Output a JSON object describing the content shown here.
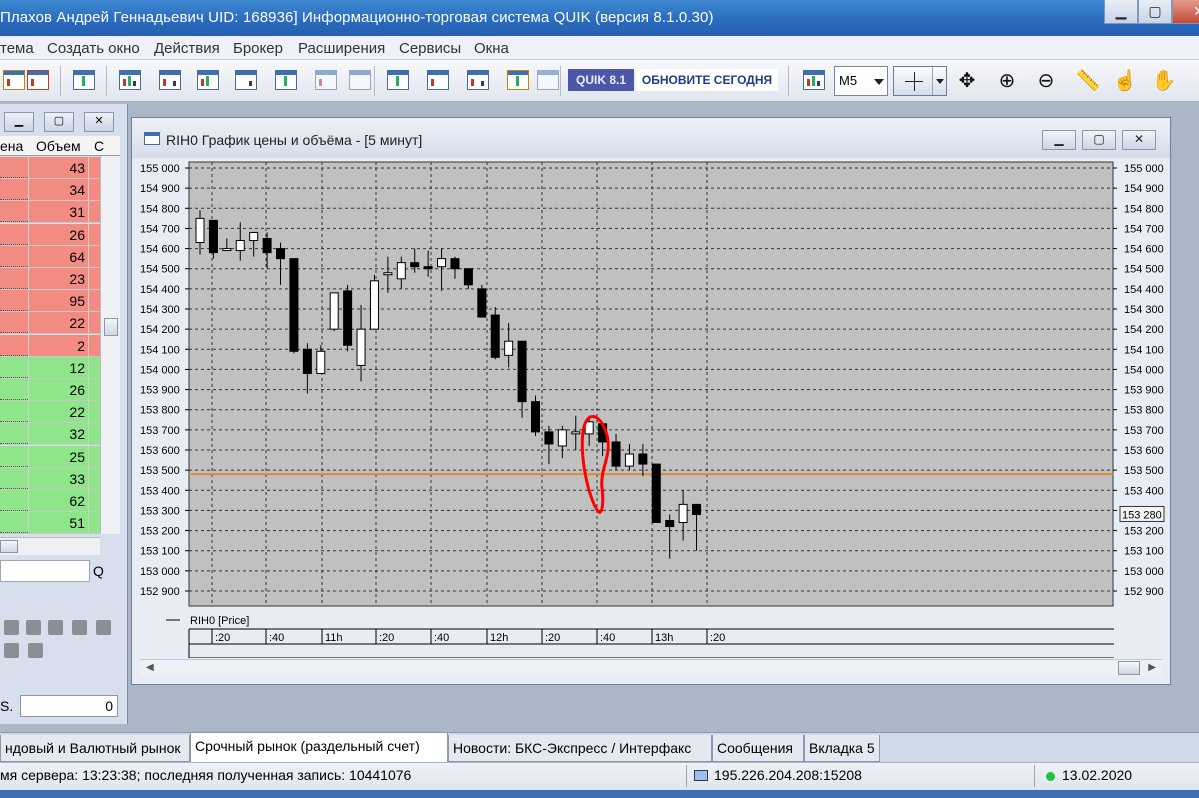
{
  "window": {
    "title": "Плахов Андрей Геннадьевич UID: 168936] Информационно-торговая система QUIK (версия 8.1.0.30)",
    "minimize": "▁",
    "maximize": "▢",
    "close": "✕"
  },
  "menu": [
    "тема",
    "Создать окно",
    "Действия",
    "Брокер",
    "Расширения",
    "Сервисы",
    "Окна"
  ],
  "toolbar": {
    "quik_badge": "QUIK 8.1",
    "update_label": "ОБНОВИТЕ СЕГОДНЯ",
    "interval": "M5"
  },
  "left_panel": {
    "col_price": "ена",
    "col_volume": "Объем",
    "col_third": "С",
    "sell_volumes": [
      "43",
      "34",
      "31",
      "26",
      "64",
      "23",
      "95",
      "22",
      "2"
    ],
    "buy_volumes": [
      "12",
      "26",
      "22",
      "32",
      "25",
      "33",
      "62",
      "51"
    ],
    "sell_color": "#f28b82",
    "buy_color": "#8ee58a",
    "search_label": "Q",
    "field_label": "S.",
    "field_value": "0"
  },
  "chart_window": {
    "title": "RIH0 График цены и объёма - [5 минут]",
    "legend": "RIH0 [Price]",
    "last_price_label": "153 280",
    "level_color": "#e08a2c",
    "annotation_color": "#ff0000"
  },
  "chart_data": {
    "type": "candlestick",
    "y_ticks": [
      "155 000",
      "154 900",
      "154 800",
      "154 700",
      "154 600",
      "154 500",
      "154 400",
      "154 300",
      "154 200",
      "154 100",
      "154 000",
      "153 900",
      "153 800",
      "153 700",
      "153 600",
      "153 500",
      "153 400",
      "153 300",
      "153 200",
      "153 100",
      "153 000",
      "152 900"
    ],
    "ylim": [
      152900,
      155000
    ],
    "time_labels": [
      ":20",
      ":40",
      "11h",
      ":20",
      ":40",
      "12h",
      ":20",
      ":40",
      "13h",
      ":20"
    ],
    "horizontal_level": 153480,
    "candles": [
      {
        "o": 154630,
        "h": 154790,
        "l": 154570,
        "c": 154750
      },
      {
        "o": 154740,
        "h": 154740,
        "l": 154550,
        "c": 154580
      },
      {
        "o": 154600,
        "h": 154650,
        "l": 154600,
        "c": 154600
      },
      {
        "o": 154590,
        "h": 154730,
        "l": 154540,
        "c": 154640
      },
      {
        "o": 154640,
        "h": 154660,
        "l": 154560,
        "c": 154680
      },
      {
        "o": 154650,
        "h": 154680,
        "l": 154500,
        "c": 154580
      },
      {
        "o": 154600,
        "h": 154630,
        "l": 154420,
        "c": 154550
      },
      {
        "o": 154550,
        "h": 154550,
        "l": 154080,
        "c": 154090
      },
      {
        "o": 154100,
        "h": 154130,
        "l": 153880,
        "c": 153980
      },
      {
        "o": 153980,
        "h": 154120,
        "l": 153980,
        "c": 154090
      },
      {
        "o": 154200,
        "h": 154380,
        "l": 154190,
        "c": 154380
      },
      {
        "o": 154390,
        "h": 154420,
        "l": 154090,
        "c": 154120
      },
      {
        "o": 154020,
        "h": 154320,
        "l": 153940,
        "c": 154200
      },
      {
        "o": 154200,
        "h": 154470,
        "l": 154200,
        "c": 154440
      },
      {
        "o": 154470,
        "h": 154560,
        "l": 154380,
        "c": 154480
      },
      {
        "o": 154450,
        "h": 154560,
        "l": 154400,
        "c": 154530
      },
      {
        "o": 154530,
        "h": 154600,
        "l": 154480,
        "c": 154510
      },
      {
        "o": 154510,
        "h": 154590,
        "l": 154460,
        "c": 154500
      },
      {
        "o": 154510,
        "h": 154600,
        "l": 154390,
        "c": 154550
      },
      {
        "o": 154550,
        "h": 154560,
        "l": 154450,
        "c": 154500
      },
      {
        "o": 154500,
        "h": 154500,
        "l": 154400,
        "c": 154420
      },
      {
        "o": 154400,
        "h": 154420,
        "l": 154270,
        "c": 154260
      },
      {
        "o": 154270,
        "h": 154310,
        "l": 154050,
        "c": 154060
      },
      {
        "o": 154070,
        "h": 154230,
        "l": 154010,
        "c": 154140
      },
      {
        "o": 154140,
        "h": 154140,
        "l": 153760,
        "c": 153840
      },
      {
        "o": 153840,
        "h": 153870,
        "l": 153670,
        "c": 153690
      },
      {
        "o": 153690,
        "h": 153720,
        "l": 153530,
        "c": 153630
      },
      {
        "o": 153620,
        "h": 153720,
        "l": 153560,
        "c": 153700
      },
      {
        "o": 153690,
        "h": 153770,
        "l": 153600,
        "c": 153690
      },
      {
        "o": 153680,
        "h": 153770,
        "l": 153620,
        "c": 153740
      },
      {
        "o": 153730,
        "h": 153730,
        "l": 153570,
        "c": 153640
      },
      {
        "o": 153640,
        "h": 153680,
        "l": 153500,
        "c": 153520
      },
      {
        "o": 153520,
        "h": 153630,
        "l": 153500,
        "c": 153580
      },
      {
        "o": 153580,
        "h": 153630,
        "l": 153470,
        "c": 153530
      },
      {
        "o": 153530,
        "h": 153530,
        "l": 153240,
        "c": 153240
      },
      {
        "o": 153250,
        "h": 153280,
        "l": 153060,
        "c": 153220
      },
      {
        "o": 153240,
        "h": 153400,
        "l": 153150,
        "c": 153330
      },
      {
        "o": 153330,
        "h": 153330,
        "l": 153100,
        "c": 153280
      }
    ]
  },
  "tabs": [
    "ндовый и Валютный рынок",
    "Срочный рынок (раздельный счет)",
    "Новости: БКС-Экспресс / Интерфакс",
    "Сообщения",
    "Вкладка 5"
  ],
  "status": {
    "server": "мя сервера: 13:23:38; последняя полученная запись: 10441076",
    "address": "195.226.204.208:15208",
    "date": "13.02.2020"
  }
}
